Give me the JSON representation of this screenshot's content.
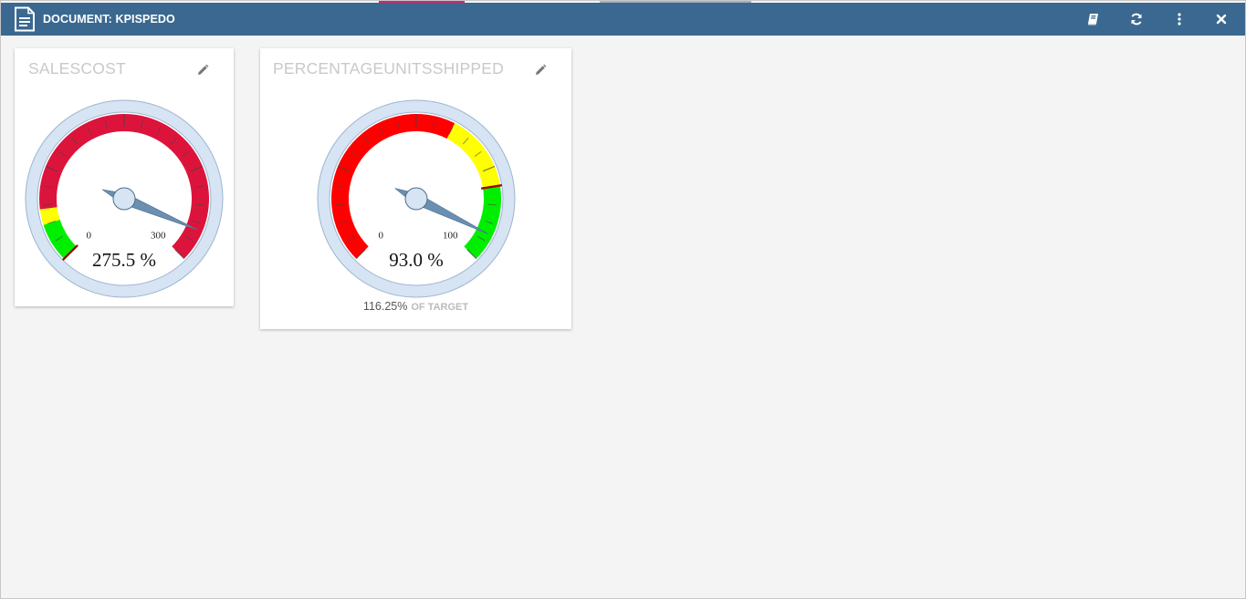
{
  "window": {
    "title": "DOCUMENT: KPISPEDO",
    "icons": [
      "document-icon",
      "book-icon",
      "refresh-icon",
      "more-vertical-icon",
      "close-icon"
    ]
  },
  "gauges": [
    {
      "title": "SALESCOST",
      "min": 0,
      "max": 300,
      "min_label": "0",
      "max_label": "300",
      "value": 275.5,
      "value_label": "275.5 %",
      "target": 0,
      "bands": [
        {
          "from": 0,
          "to": 30,
          "color": "#00ee00"
        },
        {
          "from": 30,
          "to": 42,
          "color": "#ffff00"
        },
        {
          "from": 42,
          "to": 300,
          "color": "#dc143c"
        }
      ]
    },
    {
      "title": "PERCENTAGEUNITSSHIPPED",
      "min": 0,
      "max": 100,
      "min_label": "0",
      "max_label": "100",
      "value": 93.0,
      "value_label": "93.0 %",
      "target": 80,
      "percent_of_target": "116.25%",
      "of_target_label": "OF TARGET",
      "bands": [
        {
          "from": 0,
          "to": 60,
          "color": "#ff0000"
        },
        {
          "from": 60,
          "to": 80,
          "color": "#ffff00"
        },
        {
          "from": 80,
          "to": 100,
          "color": "#00ee00"
        }
      ]
    }
  ]
}
